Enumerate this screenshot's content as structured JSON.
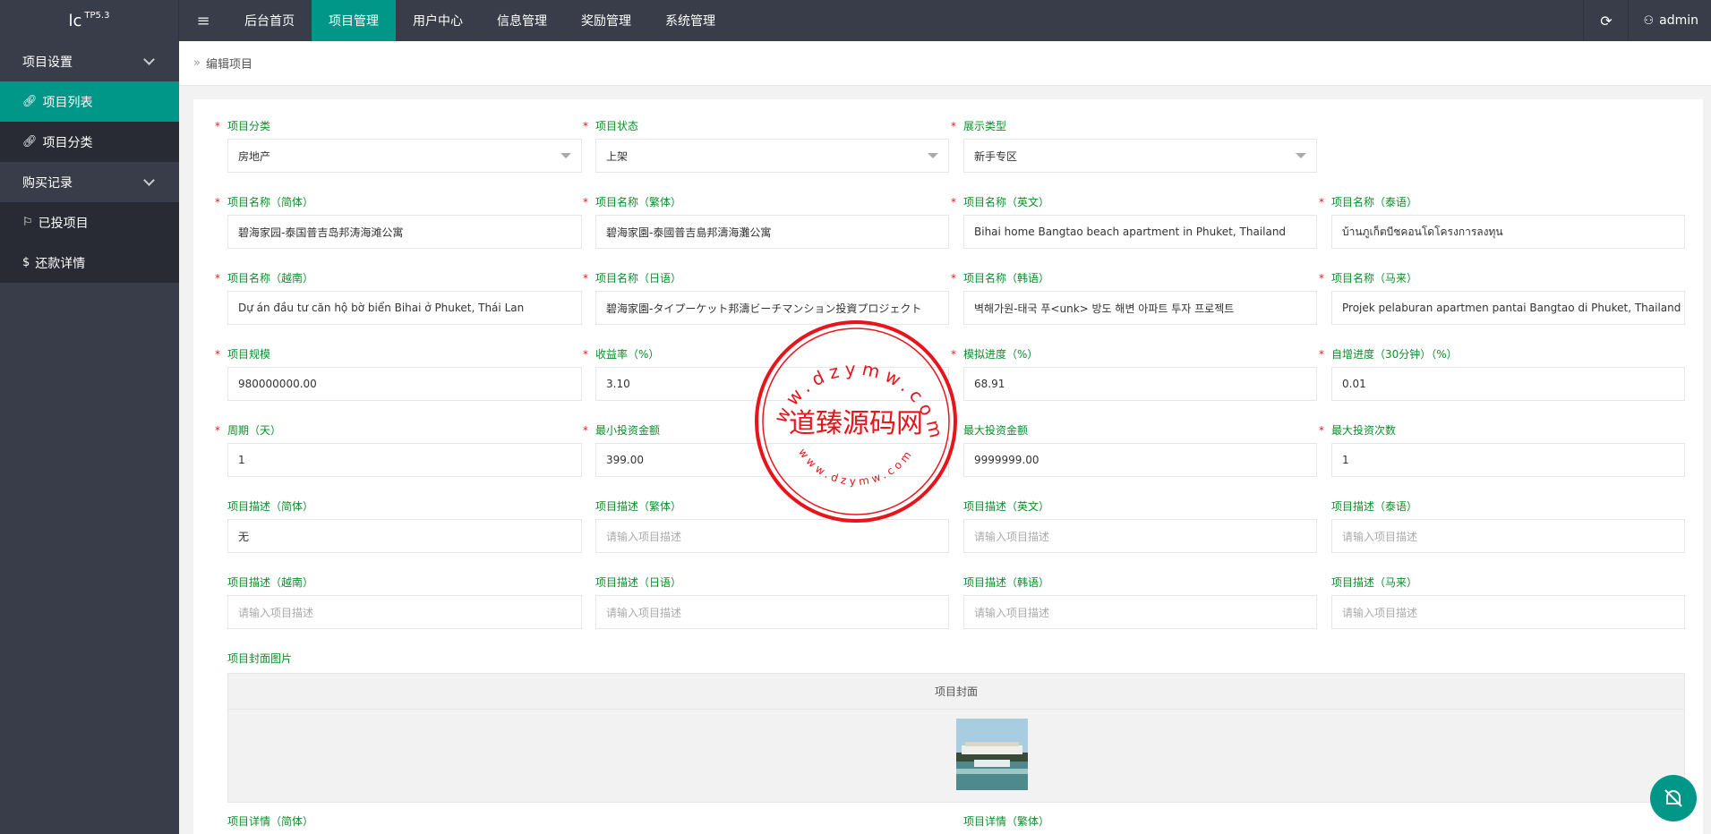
{
  "topbar": {
    "logo": "lc",
    "logo_sup": "TP5.3",
    "menu_icon": "≡",
    "nav": [
      {
        "label": "后台首页",
        "active": false
      },
      {
        "label": "项目管理",
        "active": true
      },
      {
        "label": "用户中心",
        "active": false
      },
      {
        "label": "信息管理",
        "active": false
      },
      {
        "label": "奖励管理",
        "active": false
      },
      {
        "label": "系统管理",
        "active": false
      }
    ],
    "refresh_icon": "⟳",
    "user_icon": "⚇",
    "user": "admin"
  },
  "sidebar": {
    "group1": "项目设置",
    "item1": "项目列表",
    "item2": "项目分类",
    "group2": "购买记录",
    "item3": "已投项目",
    "item4": "还款详情"
  },
  "breadcrumb": {
    "icon": "»",
    "text": "编辑项目"
  },
  "form": {
    "category": {
      "label": "项目分类",
      "value": "房地产"
    },
    "status": {
      "label": "项目状态",
      "value": "上架"
    },
    "display": {
      "label": "展示类型",
      "value": "新手专区"
    },
    "name_cn": {
      "label": "项目名称（简体）",
      "value": "碧海家园-泰国普吉岛邦涛海滩公寓"
    },
    "name_tw": {
      "label": "项目名称（繁体）",
      "value": "碧海家園-泰國普吉島邦濤海灘公寓"
    },
    "name_en": {
      "label": "项目名称（英文）",
      "value": "Bihai home Bangtao beach apartment in Phuket, Thailand"
    },
    "name_th": {
      "label": "项目名称（泰语）",
      "value": "บ้านภูเก็ตบีชคอนโดโครงการลงทุน"
    },
    "name_vi": {
      "label": "项目名称（越南）",
      "value": "Dự án đầu tư căn hộ bờ biển Bihai ở Phuket, Thái Lan"
    },
    "name_ja": {
      "label": "项目名称（日语）",
      "value": "碧海家園-タイプーケット邦濤ビーチマンション投資プロジェクト"
    },
    "name_ko": {
      "label": "项目名称（韩语）",
      "value": "벽해가원-태국 푸<unk> 방도 해변 아파트 투자 프로젝트"
    },
    "name_ms": {
      "label": "项目名称（马来）",
      "value": "Projek pelaburan apartmen pantai Bangtao di Phuket, Thailand"
    },
    "scale": {
      "label": "项目规模",
      "value": "980000000.00"
    },
    "yield": {
      "label": "收益率（%）",
      "value": "3.10"
    },
    "progress": {
      "label": "模拟进度（%）",
      "value": "68.91"
    },
    "auto_progress": {
      "label": "自增进度（30分钟）（%）",
      "value": "0.01"
    },
    "period": {
      "label": "周期（天）",
      "value": "1"
    },
    "min_invest": {
      "label": "最小投资金额",
      "value": "399.00"
    },
    "max_invest": {
      "label": "最大投资金额",
      "value": "9999999.00"
    },
    "max_times": {
      "label": "最大投资次数",
      "value": "1"
    },
    "desc_cn": {
      "label": "项目描述（简体）",
      "value": "无"
    },
    "desc_tw": {
      "label": "项目描述（繁体）",
      "placeholder": "请输入项目描述"
    },
    "desc_en": {
      "label": "项目描述（英文）",
      "placeholder": "请输入项目描述"
    },
    "desc_th": {
      "label": "项目描述（泰语）",
      "placeholder": "请输入项目描述"
    },
    "desc_vi": {
      "label": "项目描述（越南）",
      "placeholder": "请输入项目描述"
    },
    "desc_ja": {
      "label": "项目描述（日语）",
      "placeholder": "请输入项目描述"
    },
    "desc_ko": {
      "label": "项目描述（韩语）",
      "placeholder": "请输入项目描述"
    },
    "desc_ms": {
      "label": "项目描述（马来）",
      "placeholder": "请输入项目描述"
    },
    "cover_label": "项目封面图片",
    "cover_head": "项目封面",
    "detail_cn": "项目详情（简体）",
    "detail_tw": "项目详情（繁体）"
  },
  "stamp": {
    "text": "道臻源码网",
    "ring": "www.dzymw.com",
    "ring_bottom": "www.dzymw.com"
  },
  "colors": {
    "accent": "#009688",
    "dark": "#393d49",
    "label": "#0a8f2a",
    "required": "#e02020",
    "stamp": "#e8141b"
  }
}
